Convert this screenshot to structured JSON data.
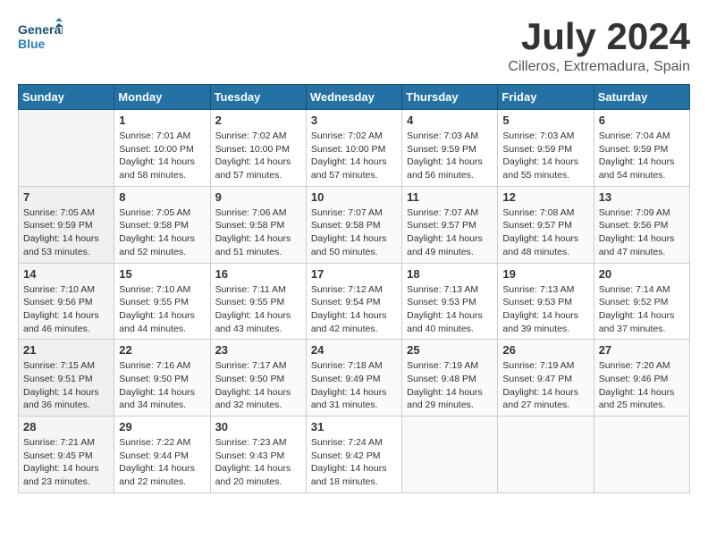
{
  "header": {
    "logo_line1": "General",
    "logo_line2": "Blue",
    "month_title": "July 2024",
    "location": "Cilleros, Extremadura, Spain"
  },
  "weekdays": [
    "Sunday",
    "Monday",
    "Tuesday",
    "Wednesday",
    "Thursday",
    "Friday",
    "Saturday"
  ],
  "weeks": [
    [
      {
        "day": "",
        "sunrise": "",
        "sunset": "",
        "daylight": ""
      },
      {
        "day": "1",
        "sunrise": "Sunrise: 7:01 AM",
        "sunset": "Sunset: 10:00 PM",
        "daylight": "Daylight: 14 hours and 58 minutes."
      },
      {
        "day": "2",
        "sunrise": "Sunrise: 7:02 AM",
        "sunset": "Sunset: 10:00 PM",
        "daylight": "Daylight: 14 hours and 57 minutes."
      },
      {
        "day": "3",
        "sunrise": "Sunrise: 7:02 AM",
        "sunset": "Sunset: 10:00 PM",
        "daylight": "Daylight: 14 hours and 57 minutes."
      },
      {
        "day": "4",
        "sunrise": "Sunrise: 7:03 AM",
        "sunset": "Sunset: 9:59 PM",
        "daylight": "Daylight: 14 hours and 56 minutes."
      },
      {
        "day": "5",
        "sunrise": "Sunrise: 7:03 AM",
        "sunset": "Sunset: 9:59 PM",
        "daylight": "Daylight: 14 hours and 55 minutes."
      },
      {
        "day": "6",
        "sunrise": "Sunrise: 7:04 AM",
        "sunset": "Sunset: 9:59 PM",
        "daylight": "Daylight: 14 hours and 54 minutes."
      }
    ],
    [
      {
        "day": "7",
        "sunrise": "Sunrise: 7:05 AM",
        "sunset": "Sunset: 9:59 PM",
        "daylight": "Daylight: 14 hours and 53 minutes."
      },
      {
        "day": "8",
        "sunrise": "Sunrise: 7:05 AM",
        "sunset": "Sunset: 9:58 PM",
        "daylight": "Daylight: 14 hours and 52 minutes."
      },
      {
        "day": "9",
        "sunrise": "Sunrise: 7:06 AM",
        "sunset": "Sunset: 9:58 PM",
        "daylight": "Daylight: 14 hours and 51 minutes."
      },
      {
        "day": "10",
        "sunrise": "Sunrise: 7:07 AM",
        "sunset": "Sunset: 9:58 PM",
        "daylight": "Daylight: 14 hours and 50 minutes."
      },
      {
        "day": "11",
        "sunrise": "Sunrise: 7:07 AM",
        "sunset": "Sunset: 9:57 PM",
        "daylight": "Daylight: 14 hours and 49 minutes."
      },
      {
        "day": "12",
        "sunrise": "Sunrise: 7:08 AM",
        "sunset": "Sunset: 9:57 PM",
        "daylight": "Daylight: 14 hours and 48 minutes."
      },
      {
        "day": "13",
        "sunrise": "Sunrise: 7:09 AM",
        "sunset": "Sunset: 9:56 PM",
        "daylight": "Daylight: 14 hours and 47 minutes."
      }
    ],
    [
      {
        "day": "14",
        "sunrise": "Sunrise: 7:10 AM",
        "sunset": "Sunset: 9:56 PM",
        "daylight": "Daylight: 14 hours and 46 minutes."
      },
      {
        "day": "15",
        "sunrise": "Sunrise: 7:10 AM",
        "sunset": "Sunset: 9:55 PM",
        "daylight": "Daylight: 14 hours and 44 minutes."
      },
      {
        "day": "16",
        "sunrise": "Sunrise: 7:11 AM",
        "sunset": "Sunset: 9:55 PM",
        "daylight": "Daylight: 14 hours and 43 minutes."
      },
      {
        "day": "17",
        "sunrise": "Sunrise: 7:12 AM",
        "sunset": "Sunset: 9:54 PM",
        "daylight": "Daylight: 14 hours and 42 minutes."
      },
      {
        "day": "18",
        "sunrise": "Sunrise: 7:13 AM",
        "sunset": "Sunset: 9:53 PM",
        "daylight": "Daylight: 14 hours and 40 minutes."
      },
      {
        "day": "19",
        "sunrise": "Sunrise: 7:13 AM",
        "sunset": "Sunset: 9:53 PM",
        "daylight": "Daylight: 14 hours and 39 minutes."
      },
      {
        "day": "20",
        "sunrise": "Sunrise: 7:14 AM",
        "sunset": "Sunset: 9:52 PM",
        "daylight": "Daylight: 14 hours and 37 minutes."
      }
    ],
    [
      {
        "day": "21",
        "sunrise": "Sunrise: 7:15 AM",
        "sunset": "Sunset: 9:51 PM",
        "daylight": "Daylight: 14 hours and 36 minutes."
      },
      {
        "day": "22",
        "sunrise": "Sunrise: 7:16 AM",
        "sunset": "Sunset: 9:50 PM",
        "daylight": "Daylight: 14 hours and 34 minutes."
      },
      {
        "day": "23",
        "sunrise": "Sunrise: 7:17 AM",
        "sunset": "Sunset: 9:50 PM",
        "daylight": "Daylight: 14 hours and 32 minutes."
      },
      {
        "day": "24",
        "sunrise": "Sunrise: 7:18 AM",
        "sunset": "Sunset: 9:49 PM",
        "daylight": "Daylight: 14 hours and 31 minutes."
      },
      {
        "day": "25",
        "sunrise": "Sunrise: 7:19 AM",
        "sunset": "Sunset: 9:48 PM",
        "daylight": "Daylight: 14 hours and 29 minutes."
      },
      {
        "day": "26",
        "sunrise": "Sunrise: 7:19 AM",
        "sunset": "Sunset: 9:47 PM",
        "daylight": "Daylight: 14 hours and 27 minutes."
      },
      {
        "day": "27",
        "sunrise": "Sunrise: 7:20 AM",
        "sunset": "Sunset: 9:46 PM",
        "daylight": "Daylight: 14 hours and 25 minutes."
      }
    ],
    [
      {
        "day": "28",
        "sunrise": "Sunrise: 7:21 AM",
        "sunset": "Sunset: 9:45 PM",
        "daylight": "Daylight: 14 hours and 23 minutes."
      },
      {
        "day": "29",
        "sunrise": "Sunrise: 7:22 AM",
        "sunset": "Sunset: 9:44 PM",
        "daylight": "Daylight: 14 hours and 22 minutes."
      },
      {
        "day": "30",
        "sunrise": "Sunrise: 7:23 AM",
        "sunset": "Sunset: 9:43 PM",
        "daylight": "Daylight: 14 hours and 20 minutes."
      },
      {
        "day": "31",
        "sunrise": "Sunrise: 7:24 AM",
        "sunset": "Sunset: 9:42 PM",
        "daylight": "Daylight: 14 hours and 18 minutes."
      },
      {
        "day": "",
        "sunrise": "",
        "sunset": "",
        "daylight": ""
      },
      {
        "day": "",
        "sunrise": "",
        "sunset": "",
        "daylight": ""
      },
      {
        "day": "",
        "sunrise": "",
        "sunset": "",
        "daylight": ""
      }
    ]
  ]
}
